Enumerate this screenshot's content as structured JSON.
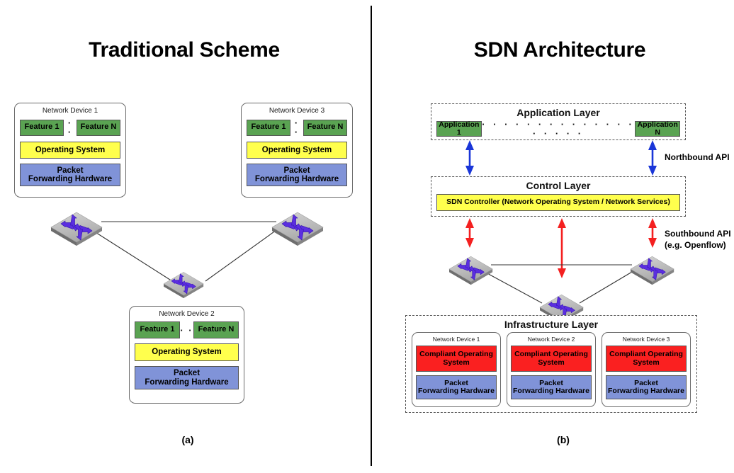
{
  "figure": {
    "left_panel": {
      "title": "Traditional Scheme",
      "caption": "(a)",
      "devices": [
        {
          "name": "Network Device 1",
          "feature_first": "Feature 1",
          "feature_dots": "· ·",
          "feature_last": "Feature N",
          "os": "Operating System",
          "hw_line1": "Packet",
          "hw_line2": "Forwarding Hardware"
        },
        {
          "name": "Network Device 3",
          "feature_first": "Feature 1",
          "feature_dots": "· ·",
          "feature_last": "Feature N",
          "os": "Operating System",
          "hw_line1": "Packet",
          "hw_line2": "Forwarding Hardware"
        },
        {
          "name": "Network Device 2",
          "feature_first": "Feature 1",
          "feature_dots": "· ·",
          "feature_last": "Feature N",
          "os": "Operating System",
          "hw_line1": "Packet",
          "hw_line2": "Forwarding Hardware"
        }
      ],
      "switch_icons": [
        "switch-icon",
        "switch-icon",
        "switch-icon"
      ]
    },
    "right_panel": {
      "title": "SDN Architecture",
      "caption": "(b)",
      "application_layer": {
        "title": "Application Layer",
        "app_first": "Application 1",
        "app_last": "Application N",
        "dots": "· · · · · · · · · · · · · · · · · · ·"
      },
      "control_layer": {
        "title": "Control Layer",
        "controller": "SDN Controller (Network Operating System / Network Services)"
      },
      "infrastructure_layer": {
        "title": "Infrastructure Layer",
        "devices": [
          {
            "name": "Network Device 1",
            "os_line1": "Compliant Operating",
            "os_line2": "System",
            "hw_line1": "Packet",
            "hw_line2": "Forwarding Hardware"
          },
          {
            "name": "Network Device 2",
            "os_line1": "Compliant Operating",
            "os_line2": "System",
            "hw_line1": "Packet",
            "hw_line2": "Forwarding Hardware"
          },
          {
            "name": "Network Device 3",
            "os_line1": "Compliant Operating",
            "os_line2": "System",
            "hw_line1": "Packet",
            "hw_line2": "Forwarding Hardware"
          }
        ]
      },
      "northbound_api": "Northbound API",
      "southbound_api_line1": "Southbound API",
      "southbound_api_line2": "(e.g. Openflow)",
      "switch_icons": [
        "switch-icon",
        "switch-icon",
        "switch-icon"
      ]
    }
  },
  "colors": {
    "feature_green": "#5aa352",
    "os_yellow": "#ffff4d",
    "hardware_blue": "#8093d8",
    "compliant_os_red": "#fa2020",
    "northbound_arrow": "#1a36d8",
    "southbound_arrow": "#f42020",
    "switch_body": "#b3b3b3",
    "switch_arrows": "#5b2ee0",
    "link_line": "#333333",
    "background": "#ffffff"
  }
}
